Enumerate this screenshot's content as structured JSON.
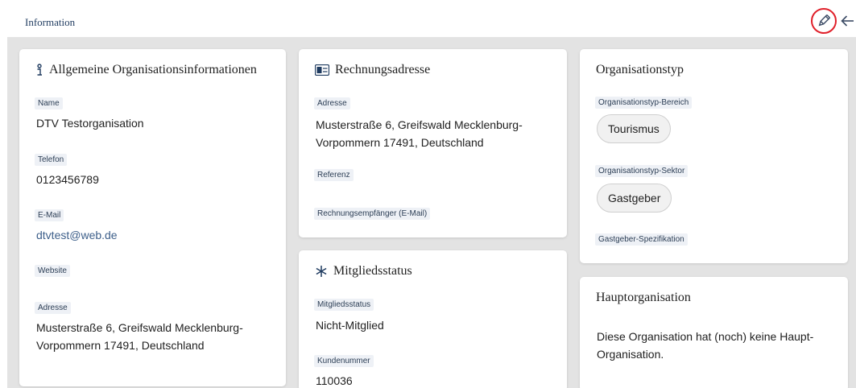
{
  "header": {
    "title": "Information",
    "edit_icon": "pencil-icon",
    "back_icon": "arrow-left-icon",
    "highlight_color": "#e0202a"
  },
  "general": {
    "title": "Allgemeine Organisationsinformationen",
    "icon": "info-icon",
    "name_label": "Name",
    "name_value": "DTV Testorganisation",
    "phone_label": "Telefon",
    "phone_value": "0123456789",
    "email_label": "E-Mail",
    "email_value": "dtvtest@web.de",
    "website_label": "Website",
    "address_label": "Adresse",
    "address_value": "Musterstraße 6, Greifswald Mecklenburg-Vorpommern 17491, Deutschland"
  },
  "billing": {
    "title": "Rechnungsadresse",
    "icon": "id-card-icon",
    "address_label": "Adresse",
    "address_value": "Musterstraße 6, Greifswald Mecklenburg-Vorpommern 17491, Deutschland",
    "reference_label": "Referenz",
    "recipient_label": "Rechnungsempfänger (E-Mail)"
  },
  "membership": {
    "title": "Mitgliedsstatus",
    "icon": "asterisk-icon",
    "status_label": "Mitgliedsstatus",
    "status_value": "Nicht-Mitglied",
    "customer_label": "Kundenummer",
    "customer_value": "110036"
  },
  "org_type": {
    "title": "Organisationstyp",
    "area_label": "Organisationstyp-Bereich",
    "area_value": "Tourismus",
    "sector_label": "Organisationstyp-Sektor",
    "sector_value": "Gastgeber",
    "spec_label": "Gastgeber-Spezifikation"
  },
  "parent": {
    "title": "Hauptorganisation",
    "text": "Diese Organisation hat (noch) keine Haupt-Organisation."
  }
}
